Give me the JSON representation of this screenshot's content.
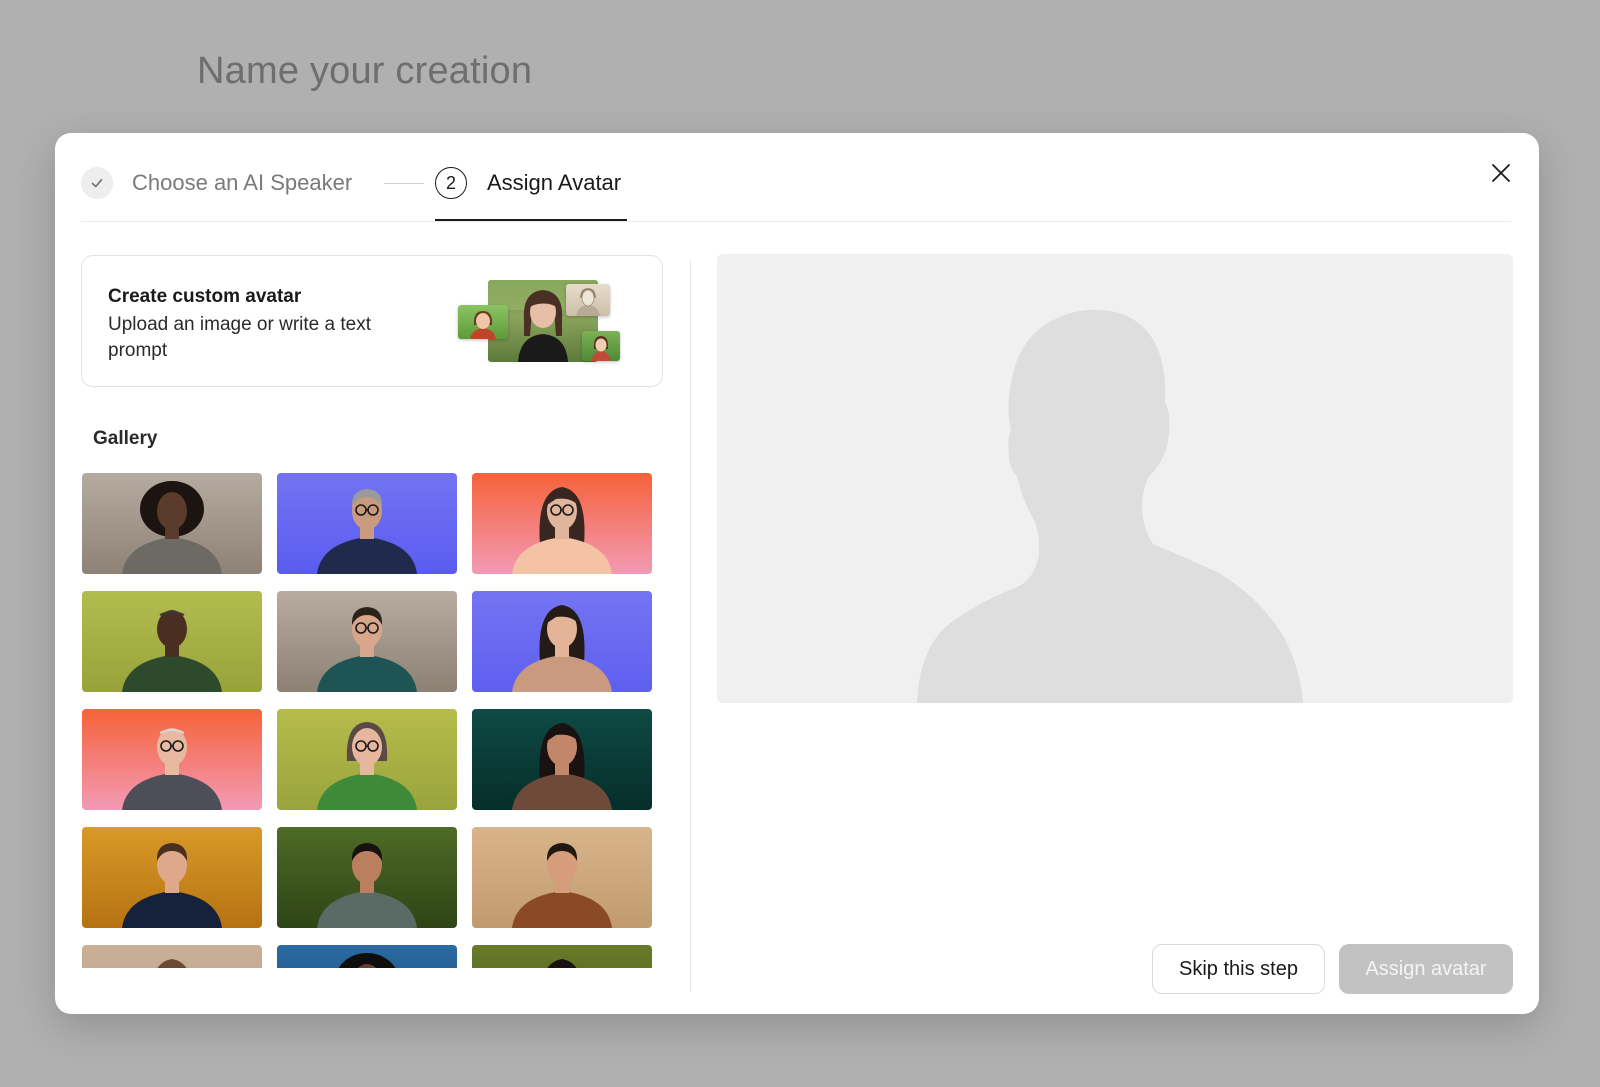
{
  "page": {
    "title": "Name your creation"
  },
  "stepper": {
    "step1": {
      "label": "Choose an AI Speaker",
      "state": "completed"
    },
    "step2": {
      "number": "2",
      "label": "Assign Avatar",
      "state": "active"
    }
  },
  "custom_avatar": {
    "title": "Create custom avatar",
    "description": "Upload an image or write a text prompt"
  },
  "gallery": {
    "label": "Gallery",
    "avatars": [
      {
        "bg": [
          "#b6aba0",
          "#8e8276"
        ],
        "skin": "#5a3b2c",
        "hair": "#1c1410",
        "shirt": "#6c6a62",
        "hair_style": "curly"
      },
      {
        "bg": [
          "#7373f2",
          "#5a5cf0"
        ],
        "skin": "#c99a7e",
        "hair": "#9a9a9a",
        "shirt": "#1f2a4c",
        "hair_style": "short",
        "glasses": true
      },
      {
        "bg": [
          "#f6623a",
          "#f29ab5"
        ],
        "skin": "#e1b49c",
        "hair": "#3a2620",
        "shirt": "#f4c3a6",
        "hair_style": "long",
        "glasses": true
      },
      {
        "bg": [
          "#b3bc4e",
          "#97a33a"
        ],
        "skin": "#4b2e22",
        "hair": "#3a3a38",
        "shirt": "#2d4a2c",
        "hair_style": "bald"
      },
      {
        "bg": [
          "#b8aca1",
          "#8d8174"
        ],
        "skin": "#d8a78b",
        "hair": "#2b221c",
        "shirt": "#1f5454",
        "hair_style": "short",
        "glasses": true
      },
      {
        "bg": [
          "#7474f2",
          "#5e5ff0"
        ],
        "skin": "#e4b498",
        "hair": "#241a16",
        "shirt": "#c99a80",
        "hair_style": "long"
      },
      {
        "bg": [
          "#f6623a",
          "#f29ab5"
        ],
        "skin": "#e6b9a0",
        "hair": "#d9d9d9",
        "shirt": "#4e4e58",
        "hair_style": "bald",
        "glasses": true
      },
      {
        "bg": [
          "#b6bc4c",
          "#9aa43c"
        ],
        "skin": "#e6b79c",
        "hair": "#5a4a46",
        "shirt": "#3f8a3a",
        "hair_style": "bob",
        "glasses": true
      },
      {
        "bg": [
          "#0f4a44",
          "#062e2a"
        ],
        "skin": "#c2876a",
        "hair": "#1a1210",
        "shirt": "#6e4a3a",
        "hair_style": "long"
      },
      {
        "bg": [
          "#d89a28",
          "#b67212"
        ],
        "skin": "#dfa88a",
        "hair": "#4a3020",
        "shirt": "#16223a",
        "hair_style": "short"
      },
      {
        "bg": [
          "#4e6b26",
          "#2e4416"
        ],
        "skin": "#b97f5e",
        "hair": "#161210",
        "shirt": "#5a6a64",
        "hair_style": "short"
      },
      {
        "bg": [
          "#d9b48a",
          "#c19a70"
        ],
        "skin": "#d69c7c",
        "hair": "#221812",
        "shirt": "#8a4a26",
        "hair_style": "short"
      },
      {
        "bg": [
          "#cbb098",
          "#b69a80"
        ],
        "skin": "#d9a687",
        "hair": "#6a4a30",
        "shirt": "#6a5a4a",
        "hair_style": "long"
      },
      {
        "bg": [
          "#2a6aa0",
          "#1a4a78"
        ],
        "skin": "#6a4028",
        "hair": "#0e0e0e",
        "shirt": "#2a3a4a",
        "hair_style": "curly"
      },
      {
        "bg": [
          "#6a7a2a",
          "#4a5a1a"
        ],
        "skin": "#c48a68",
        "hair": "#1a1210",
        "shirt": "#3a3a3a",
        "hair_style": "long"
      }
    ]
  },
  "preview": {
    "silhouette_color": "#dedede"
  },
  "footer": {
    "skip_label": "Skip this step",
    "assign_label": "Assign avatar",
    "assign_disabled": true
  },
  "colors": {
    "overlay": "#b0b0b0",
    "modal_bg": "#ffffff",
    "preview_bg": "#f0f0f0",
    "disabled_button": "#c2c2c2"
  }
}
